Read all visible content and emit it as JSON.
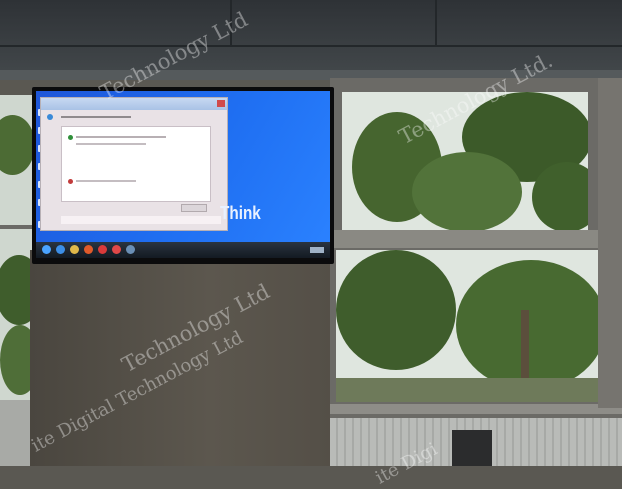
{
  "screen": {
    "brand_text": "Think"
  },
  "watermark": {
    "text_1": "Technology Ltd",
    "text_2": "Technology Ltd.",
    "text_3": "Technology Ltd",
    "text_4": "ite Digital Technology Ltd",
    "text_5": "ite Digi"
  },
  "colors": {
    "desktop_blue": "#1f6ff2",
    "tv_bezel": "#0b0b0c",
    "tree_green": "#3f5d2c",
    "ceiling": "#3a3f42"
  },
  "icons": [
    "start-orb-icon",
    "ie-icon",
    "folder-icon",
    "media-icon",
    "chrome-icon",
    "app-icon"
  ]
}
